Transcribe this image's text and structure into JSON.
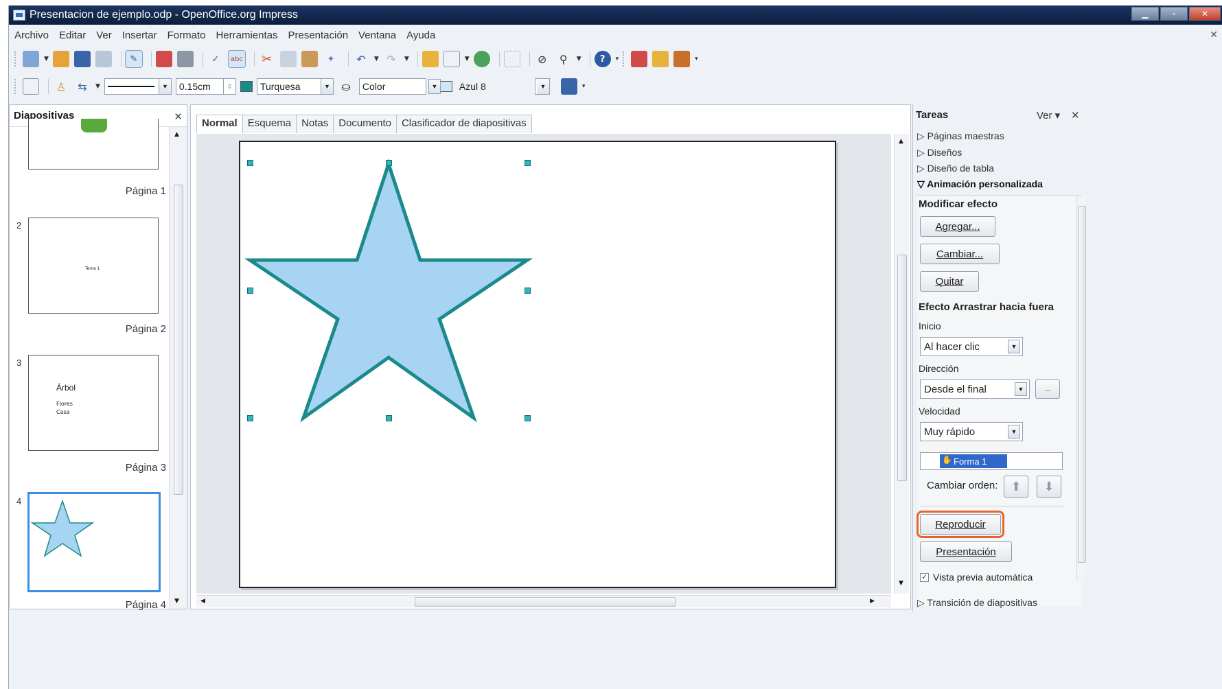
{
  "window": {
    "title": "Presentacion de ejemplo.odp - OpenOffice.org Impress"
  },
  "menu": [
    "Archivo",
    "Editar",
    "Ver",
    "Insertar",
    "Formato",
    "Herramientas",
    "Presentación",
    "Ventana",
    "Ayuda"
  ],
  "toolbar2": {
    "line_width": "0.15cm",
    "line_color": "Turquesa",
    "area_style": "Color",
    "area_color": "Azul 8",
    "colors": {
      "turquesa": "#1a8a8a",
      "azul8": "#cfe6f8"
    }
  },
  "slides_pane": {
    "title": "Diapositivas",
    "slides": [
      {
        "number": "",
        "label": "Página 1"
      },
      {
        "number": "2",
        "label": "Página 2",
        "text": "Tema 1"
      },
      {
        "number": "3",
        "label": "Página 3",
        "title": "Árbol",
        "lines": [
          "Flores",
          "Casa"
        ]
      },
      {
        "number": "4",
        "label": "Página 4"
      }
    ]
  },
  "view_tabs": [
    "Normal",
    "Esquema",
    "Notas",
    "Documento",
    "Clasificador de diapositivas"
  ],
  "tasks": {
    "title": "Tareas",
    "view_label": "Ver",
    "sections": [
      "Páginas maestras",
      "Diseños",
      "Diseño de tabla",
      "Animación personalizada",
      "Transición de diapositivas"
    ],
    "modify_effect": "Modificar efecto",
    "add": "Agregar...",
    "change": "Cambiar...",
    "remove": "Quitar",
    "effect_title": "Efecto Arrastrar hacia fuera",
    "start_label": "Inicio",
    "start_value": "Al hacer clic",
    "direction_label": "Dirección",
    "direction_value": "Desde el final",
    "direction_more": "...",
    "speed_label": "Velocidad",
    "speed_value": "Muy rápido",
    "effect_item": "Forma 1",
    "change_order": "Cambiar orden:",
    "play": "Reproducir",
    "slideshow": "Presentación",
    "auto_preview": "Vista previa automática",
    "auto_preview_checked": true
  },
  "star": {
    "fill": "#a7d4f3",
    "stroke": "#1a8a8a"
  }
}
